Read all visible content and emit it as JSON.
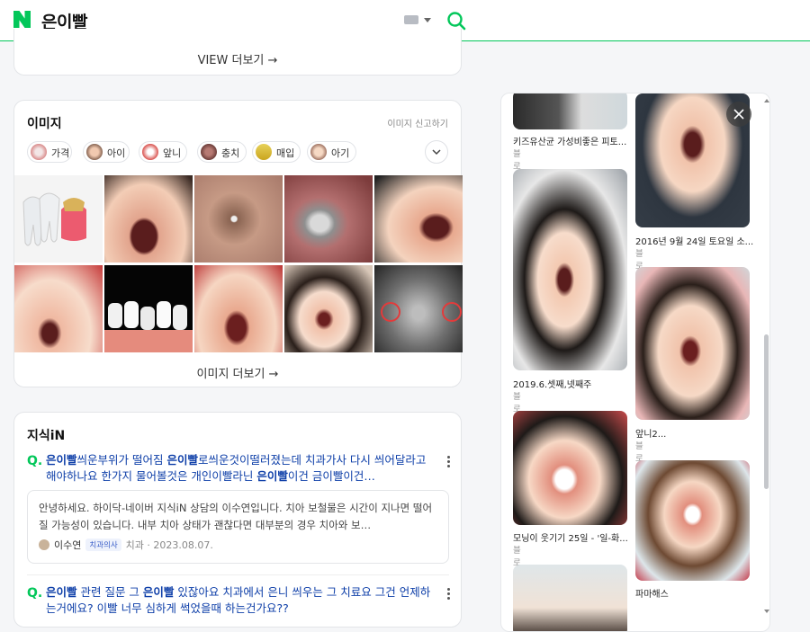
{
  "header": {
    "logo_letter": "N",
    "query": "은이빨",
    "brand_color": "#03c75a"
  },
  "top_card": {
    "more_label": "VIEW 더보기 →"
  },
  "images_section": {
    "title": "이미지",
    "report_label": "이미지 신고하기",
    "chips": [
      {
        "label": "가격"
      },
      {
        "label": "아이"
      },
      {
        "label": "앞니"
      },
      {
        "label": "충치"
      },
      {
        "label": "매입"
      },
      {
        "label": "아기"
      }
    ],
    "more_label": "이미지 더보기 →"
  },
  "kin_section": {
    "title": "지식iN",
    "q_icon": "Q.",
    "q1_parts": [
      "은이빨",
      "씌운부위가 떨어짐 ",
      "은이빨",
      "로씌운것이떨러졌는데 치과가사 다시 씌어달라고해야하나요 한가지 물어볼것은 개인이빨라닌 ",
      "은이빨",
      "이건 금이빨이건…"
    ],
    "answer": "안녕하세요. 하이닥-네이버 지식iN 상담의 이수연입니다. 치아 보철물은 시간이 지나면 떨어질 가능성이 있습니다. 내부 치아 상태가 괜찮다면 대부분의 경우 치아와 보…",
    "author_name": "이수연",
    "author_badge": "치과의사",
    "author_meta": "치과 · 2023.08.07.",
    "q2_parts": [
      "은이빨",
      " 관련 질문 그 ",
      "은이빨",
      " 있잖아요 치과에서 은니 씌우는 그 치료요 그건 언제하는거에요? 이빨 너무 심하게 썩었을때 하는건가요??"
    ]
  },
  "viewer": {
    "items": [
      {
        "caption": "키즈유산균 가성비좋은 피토...",
        "source": "블로그"
      },
      {
        "caption": "2016년 9월 24일 토요일 소...",
        "source": "블로그"
      },
      {
        "caption": "2019.6.셋째,넷째주",
        "source": "블로그"
      },
      {
        "caption": "앞니2...",
        "source": "블로그"
      },
      {
        "caption": "모닝이 웃기기 25일 - '일-화...",
        "source": "블로그"
      },
      {
        "caption": "파마해스",
        "source": ""
      }
    ]
  }
}
